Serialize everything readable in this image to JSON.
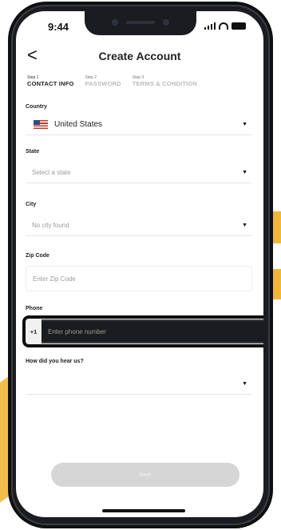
{
  "status_bar": {
    "time": "9:44"
  },
  "header": {
    "title": "Create Account",
    "back_glyph": "<"
  },
  "steps": [
    {
      "small": "Step 1",
      "big": "CONTACT INFO",
      "active": true
    },
    {
      "small": "Step 2",
      "big": "PASSWORD",
      "active": false
    },
    {
      "small": "Step 3",
      "big": "TERMS & CONDITION",
      "active": false
    }
  ],
  "form": {
    "country": {
      "label": "Country",
      "value": "United States"
    },
    "state": {
      "label": "State",
      "placeholder": "Select a state"
    },
    "city": {
      "label": "City",
      "placeholder": "No city found"
    },
    "zip": {
      "label": "Zip Code",
      "placeholder": "Enter Zip Code"
    },
    "phone": {
      "label": "Phone",
      "prefix": "+1",
      "placeholder": "Enter phone number"
    },
    "referral": {
      "label": "How did you hear us?",
      "value": ""
    }
  },
  "next_button": {
    "label": "Next"
  },
  "icons": {
    "caret": "▼",
    "flag": "us-flag-icon"
  },
  "colors": {
    "accent": "#f2b63a",
    "button_disabled": "#d6d6d6"
  }
}
